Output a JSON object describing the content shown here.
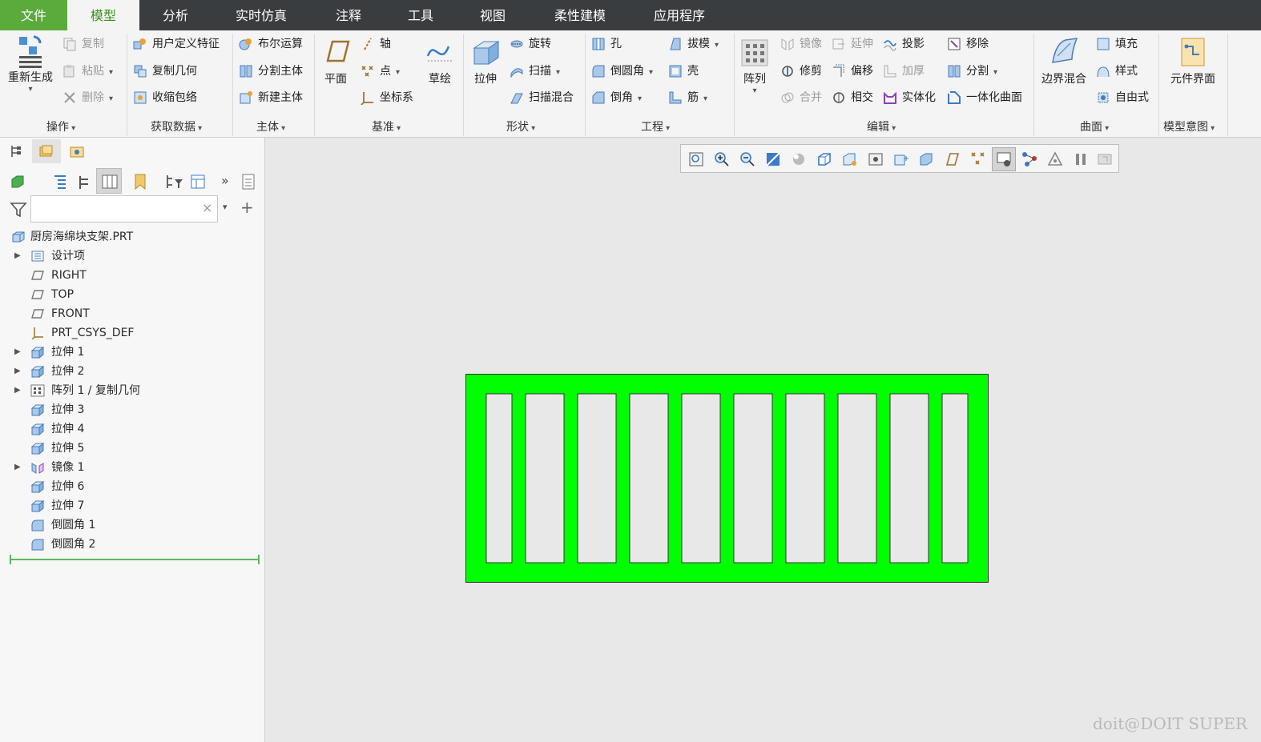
{
  "menu": {
    "tabs": [
      "文件",
      "模型",
      "分析",
      "实时仿真",
      "注释",
      "工具",
      "视图",
      "柔性建模",
      "应用程序"
    ],
    "active_tab": "模型"
  },
  "ribbon": {
    "operations": {
      "regenerate": "重新生成",
      "copy": "复制",
      "paste": "粘贴",
      "delete": "删除",
      "label": "操作"
    },
    "get_data": {
      "udf": "用户定义特征",
      "copy_geom": "复制几何",
      "shrinkwrap": "收缩包络",
      "label": "获取数据"
    },
    "body": {
      "boolean": "布尔运算",
      "split_body": "分割主体",
      "new_body": "新建主体",
      "label": "主体"
    },
    "datum": {
      "plane": "平面",
      "axis": "轴",
      "point": "点",
      "csys": "坐标系",
      "sketch": "草绘",
      "label": "基准"
    },
    "shapes": {
      "extrude": "拉伸",
      "revolve": "旋转",
      "sweep": "扫描",
      "swept_blend": "扫描混合",
      "label": "形状"
    },
    "engineering": {
      "hole": "孔",
      "round": "倒圆角",
      "chamfer": "倒角",
      "draft": "拔模",
      "shell": "壳",
      "rib": "筋",
      "label": "工程"
    },
    "editing": {
      "pattern": "阵列",
      "mirror": "镜像",
      "extend": "延伸",
      "project": "投影",
      "trim": "修剪",
      "offset": "偏移",
      "thicken": "加厚",
      "merge": "合并",
      "intersect": "相交",
      "solidify": "实体化",
      "remove": "移除",
      "split": "分割",
      "unify": "一体化曲面",
      "label": "编辑"
    },
    "surfaces": {
      "boundary_blend": "边界混合",
      "fill": "填充",
      "style": "样式",
      "freestyle": "自由式",
      "label": "曲面"
    },
    "model_intent": {
      "component_interface": "元件界面",
      "label": "模型意图"
    }
  },
  "model_tree": {
    "search_placeholder": "",
    "root": "厨房海绵块支架.PRT",
    "items": [
      {
        "label": "设计项",
        "expandable": true,
        "icon": "design-items-icon"
      },
      {
        "label": "RIGHT",
        "expandable": false,
        "icon": "datum-plane-icon"
      },
      {
        "label": "TOP",
        "expandable": false,
        "icon": "datum-plane-icon"
      },
      {
        "label": "FRONT",
        "expandable": false,
        "icon": "datum-plane-icon"
      },
      {
        "label": "PRT_CSYS_DEF",
        "expandable": false,
        "icon": "csys-icon"
      },
      {
        "label": "拉伸 1",
        "expandable": true,
        "icon": "extrude-icon"
      },
      {
        "label": "拉伸 2",
        "expandable": true,
        "icon": "extrude-icon"
      },
      {
        "label": "阵列 1 / 复制几何",
        "expandable": true,
        "icon": "pattern-icon"
      },
      {
        "label": "拉伸 3",
        "expandable": false,
        "icon": "extrude-icon"
      },
      {
        "label": "拉伸 4",
        "expandable": false,
        "icon": "extrude-icon"
      },
      {
        "label": "拉伸 5",
        "expandable": false,
        "icon": "extrude-icon"
      },
      {
        "label": "镜像 1",
        "expandable": true,
        "icon": "mirror-icon"
      },
      {
        "label": "拉伸 6",
        "expandable": false,
        "icon": "extrude-icon"
      },
      {
        "label": "拉伸 7",
        "expandable": false,
        "icon": "extrude-icon"
      },
      {
        "label": "倒圆角 1",
        "expandable": false,
        "icon": "round-icon"
      },
      {
        "label": "倒圆角 2",
        "expandable": false,
        "icon": "round-icon"
      }
    ]
  },
  "colors": {
    "model_green": "#00ff00",
    "accent_green": "#5aaa3c",
    "menubar": "#3a3d40",
    "slot_fill": "#e8e8e8"
  },
  "watermark": "doit@DOIT SUPER"
}
